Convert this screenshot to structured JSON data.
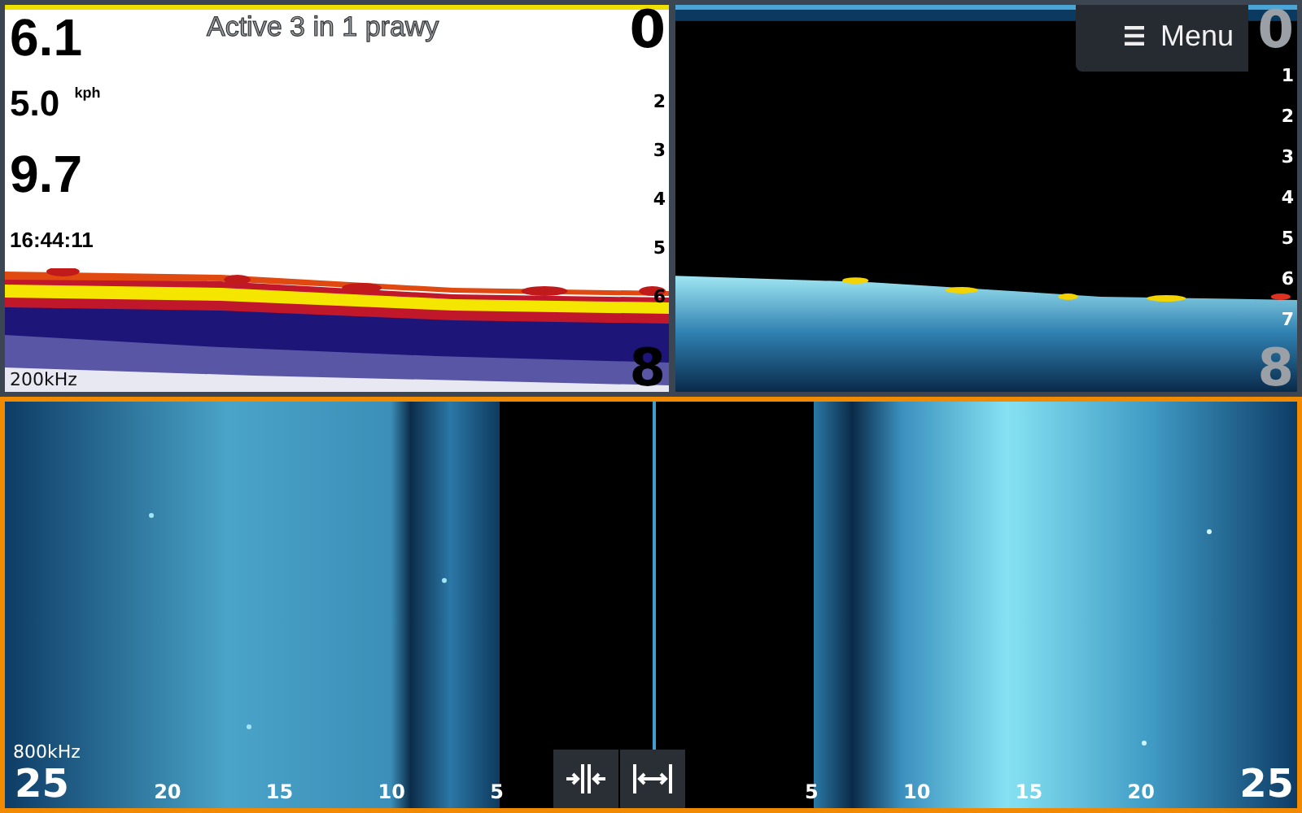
{
  "top_left_pane": {
    "selected": false,
    "title": "Active 3 in 1 prawy",
    "readouts": [
      {
        "value": "6.1",
        "kind": "large"
      },
      {
        "value": "5.0",
        "unit": "kph",
        "kind": "medium"
      },
      {
        "value": "9.7",
        "kind": "large"
      },
      {
        "value": "16:44:11",
        "kind": "small"
      }
    ],
    "frequency": "200kHz",
    "depth_scale": [
      {
        "label": "0",
        "kind": "big"
      },
      {
        "label": "2",
        "kind": "small"
      },
      {
        "label": "3",
        "kind": "small"
      },
      {
        "label": "4",
        "kind": "small"
      },
      {
        "label": "5",
        "kind": "small"
      },
      {
        "label": "6",
        "kind": "small"
      },
      {
        "label": "8",
        "kind": "big"
      }
    ]
  },
  "top_right_pane": {
    "selected": false,
    "menu_button": {
      "label": "Menu"
    },
    "depth_scale": [
      {
        "label": "0",
        "kind": "big"
      },
      {
        "label": "1",
        "kind": "small"
      },
      {
        "label": "2",
        "kind": "small"
      },
      {
        "label": "3",
        "kind": "small"
      },
      {
        "label": "4",
        "kind": "small"
      },
      {
        "label": "5",
        "kind": "small"
      },
      {
        "label": "6",
        "kind": "small"
      },
      {
        "label": "7",
        "kind": "small"
      },
      {
        "label": "8",
        "kind": "big"
      }
    ]
  },
  "bottom_pane": {
    "selected": true,
    "frequency": "800kHz",
    "left_scale": [
      {
        "label": "25",
        "kind": "big"
      },
      {
        "label": "20",
        "kind": "small"
      },
      {
        "label": "15",
        "kind": "small"
      },
      {
        "label": "10",
        "kind": "small"
      },
      {
        "label": "5",
        "kind": "small"
      }
    ],
    "right_scale": [
      {
        "label": "5",
        "kind": "small"
      },
      {
        "label": "10",
        "kind": "small"
      },
      {
        "label": "15",
        "kind": "small"
      },
      {
        "label": "20",
        "kind": "small"
      },
      {
        "label": "25",
        "kind": "big"
      }
    ]
  }
}
